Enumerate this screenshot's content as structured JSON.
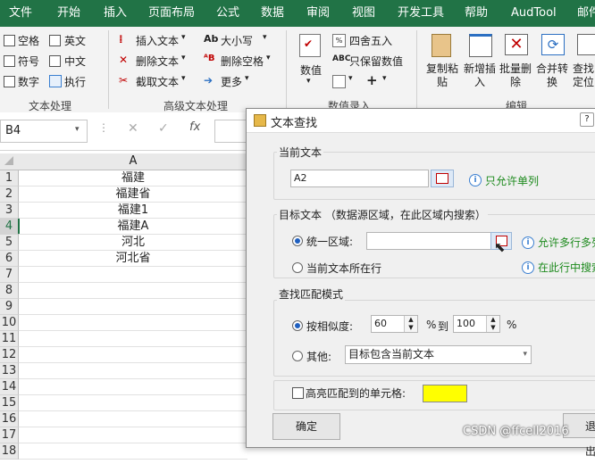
{
  "ribbon_tabs": [
    "文件",
    "开始",
    "插入",
    "页面布局",
    "公式",
    "数据",
    "审阅",
    "视图",
    "开发工具",
    "帮助",
    "AudTool",
    "邮件"
  ],
  "ribbon": {
    "text_process": {
      "items": [
        "空格",
        "英文",
        "符号",
        "中文",
        "数字",
        "执行"
      ],
      "group": "文本处理"
    },
    "advanced_text": {
      "items": [
        "插入文本",
        "删除文本",
        "截取文本",
        "大小写",
        "删除空格",
        "更多"
      ],
      "group": "高级文本处理"
    },
    "data_entry": {
      "big": "数值",
      "items": [
        "四舍五入",
        "只保留数值"
      ],
      "group": "数值录入"
    },
    "edit": {
      "items": [
        "复制粘贴",
        "新增插入",
        "批量删除",
        "合并转换",
        "查找定位"
      ],
      "group": "编辑"
    }
  },
  "formula_bar": {
    "name_box": "B4",
    "fx": "fx"
  },
  "sheet": {
    "column_header": "A",
    "rows": [
      {
        "n": "1",
        "v": "福建"
      },
      {
        "n": "2",
        "v": "福建省"
      },
      {
        "n": "3",
        "v": "福建1"
      },
      {
        "n": "4",
        "v": "福建A"
      },
      {
        "n": "5",
        "v": "河北"
      },
      {
        "n": "6",
        "v": "河北省"
      },
      {
        "n": "7",
        "v": ""
      },
      {
        "n": "8",
        "v": ""
      },
      {
        "n": "9",
        "v": ""
      },
      {
        "n": "10",
        "v": ""
      },
      {
        "n": "11",
        "v": ""
      },
      {
        "n": "12",
        "v": ""
      },
      {
        "n": "13",
        "v": ""
      },
      {
        "n": "14",
        "v": ""
      },
      {
        "n": "15",
        "v": ""
      },
      {
        "n": "16",
        "v": ""
      },
      {
        "n": "17",
        "v": ""
      },
      {
        "n": "18",
        "v": ""
      }
    ]
  },
  "dialog": {
    "title": "文本查找",
    "current_text": {
      "label": "当前文本",
      "value": "A2",
      "hint": "只允许单列"
    },
    "target": {
      "label": "目标文本 （数据源区域，在此区域内搜索）",
      "opt1": "统一区域:",
      "opt1_hint": "允许多行多列",
      "opt2": "当前文本所在行",
      "opt2_hint": "在此行中搜索"
    },
    "match": {
      "label": "查找匹配模式",
      "by_similarity": "按相似度:",
      "from": "60",
      "pct1": "%",
      "to_word": "到",
      "to": "100",
      "pct2": "%",
      "other": "其他:",
      "other_value": "目标包含当前文本"
    },
    "highlight": {
      "label": "高亮匹配到的单元格:",
      "color": "#ffff00"
    },
    "ok": "确定",
    "cancel": "退出"
  },
  "watermark": "CSDN @ffcell2016"
}
